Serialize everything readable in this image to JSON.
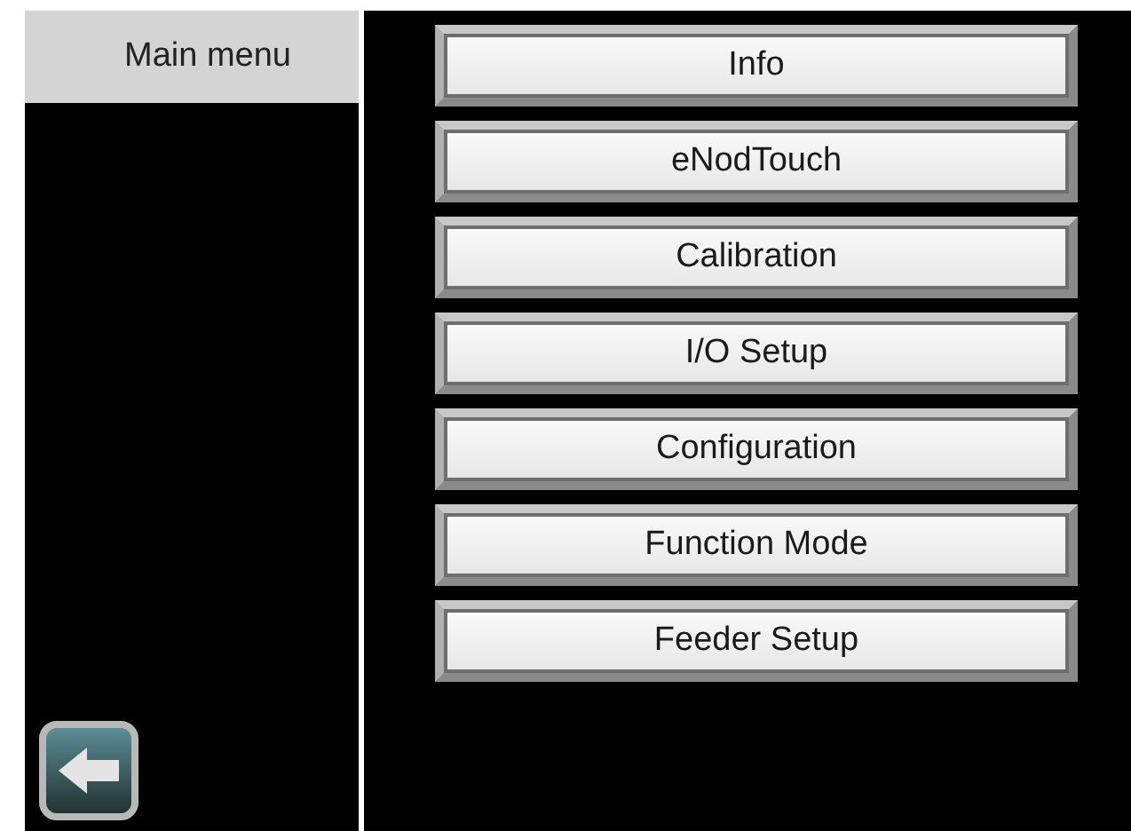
{
  "sidebar": {
    "title": "Main menu"
  },
  "menu_buttons": [
    {
      "label": "Info"
    },
    {
      "label": "eNodTouch"
    },
    {
      "label": "Calibration"
    },
    {
      "label": "I/O Setup"
    },
    {
      "label": "Configuration"
    },
    {
      "label": "Function Mode"
    },
    {
      "label": "Feeder Setup"
    }
  ]
}
